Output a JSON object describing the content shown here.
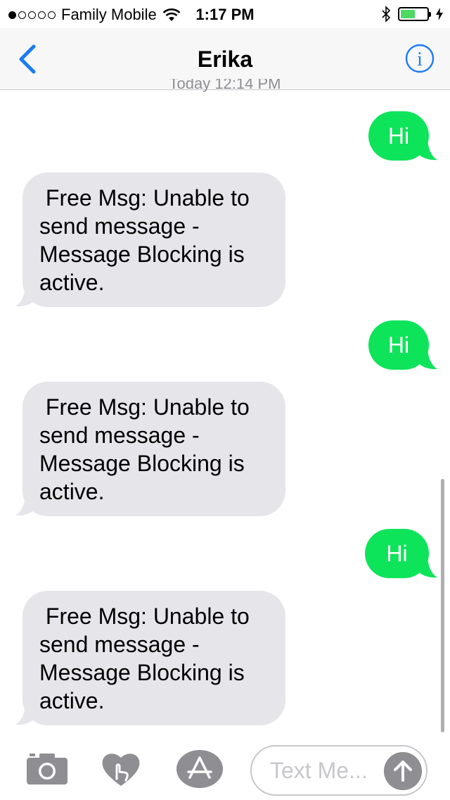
{
  "status_bar": {
    "carrier": "Family Mobile",
    "time": "1:17 PM",
    "signal_bars": 1,
    "battery_level": 0.5
  },
  "nav": {
    "back_icon": "chevron-left-icon",
    "title": "Erika",
    "info_icon": "info-icon"
  },
  "timestamp": "Today 12:14 PM",
  "messages": [
    {
      "direction": "outgoing",
      "text": "Hi"
    },
    {
      "direction": "incoming",
      "text": " Free Msg: Unable to send message - Message Blocking is active."
    },
    {
      "direction": "outgoing",
      "text": "Hi"
    },
    {
      "direction": "incoming",
      "text": " Free Msg: Unable to send message - Message Blocking is active."
    },
    {
      "direction": "outgoing",
      "text": "Hi"
    },
    {
      "direction": "incoming",
      "text": " Free Msg: Unable to send message - Message Blocking is active."
    }
  ],
  "incoming_lines": [
    " Free Msg: Unable to",
    "send message -",
    "Message Blocking is",
    "active."
  ],
  "composer": {
    "placeholder": "Text Me...",
    "icons": [
      "camera-icon",
      "digital-touch-icon",
      "app-store-icon",
      "send-arrow-icon"
    ]
  },
  "colors": {
    "outgoing_bubble": "#0ee45a",
    "incoming_bubble": "#e5e5ea",
    "accent": "#1a7cf5"
  }
}
